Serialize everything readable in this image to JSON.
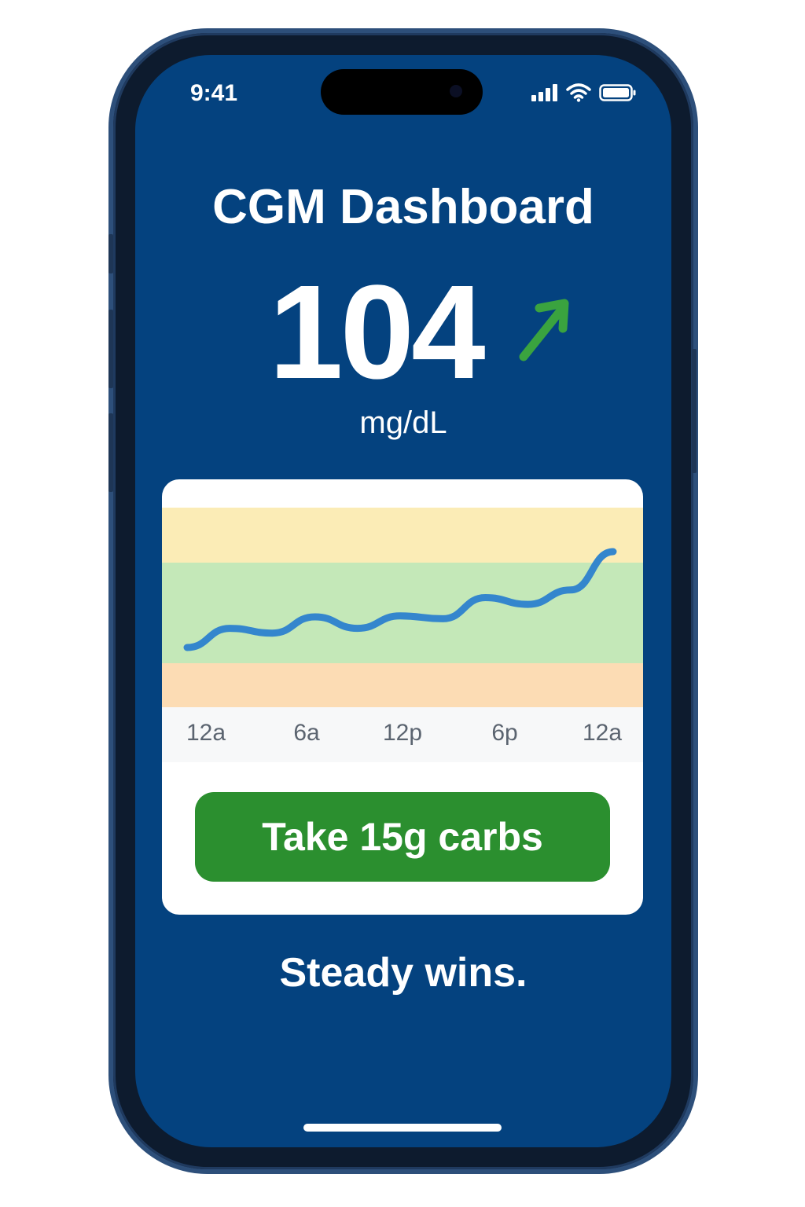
{
  "status_bar": {
    "time": "9:41",
    "icons": [
      "cellular-signal-icon",
      "wifi-icon",
      "battery-icon"
    ]
  },
  "header": {
    "title": "CGM Dashboard"
  },
  "glucose": {
    "value": "104",
    "unit": "mg/dL",
    "trend_icon": "trend-up-arrow-icon",
    "trend_color": "#3aa33f"
  },
  "chart_data": {
    "type": "line",
    "x_ticks": [
      "12a",
      "6a",
      "12p",
      "6p",
      "12a"
    ],
    "bands": [
      {
        "color": "#fbecb6"
      },
      {
        "color": "#c4e8b8"
      },
      {
        "color": "#fcdcb4"
      }
    ],
    "series": [
      {
        "color": "#3486cd",
        "values": [
          0.0,
          0.2,
          0.15,
          0.32,
          0.2,
          0.33,
          0.3,
          0.52,
          0.45,
          0.6,
          1.0
        ]
      }
    ]
  },
  "action": {
    "label": "Take 15g carbs",
    "color": "#2b8f2f"
  },
  "tagline": "Steady wins.",
  "colors": {
    "screen_bg": "#04427f",
    "frame": "#0d1b2e"
  }
}
